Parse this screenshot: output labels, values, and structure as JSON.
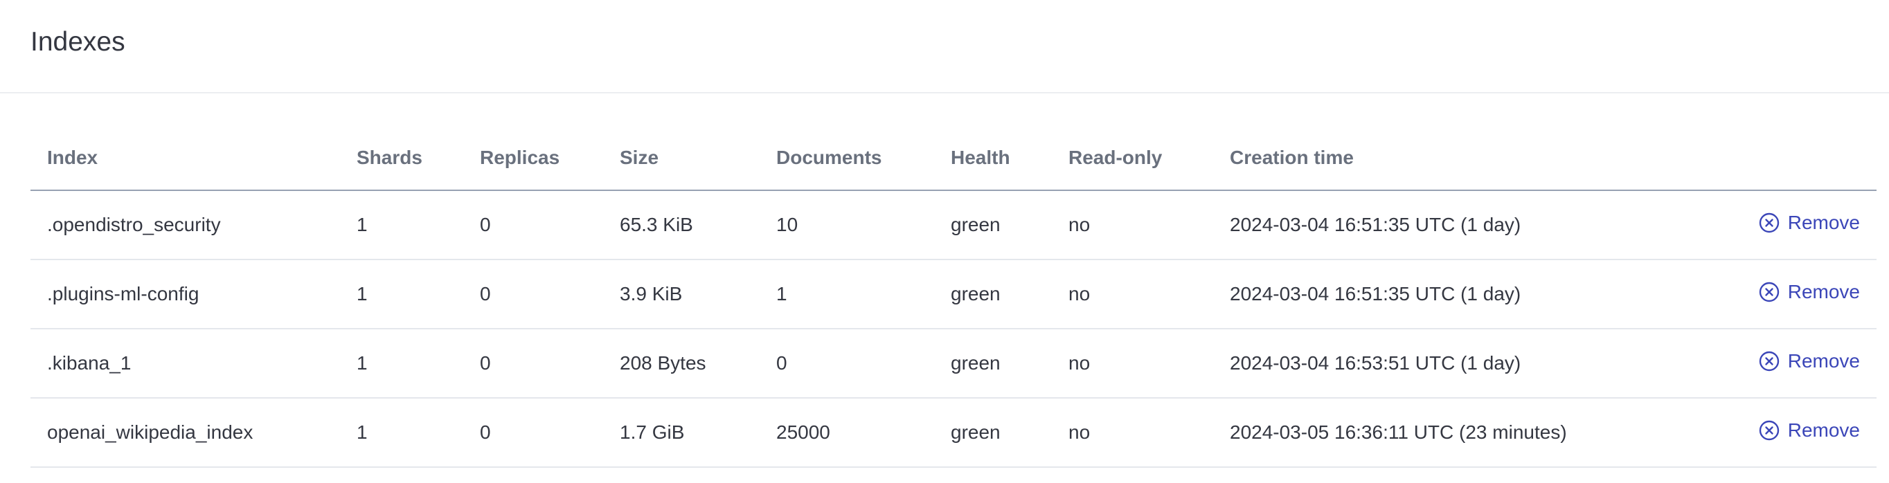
{
  "page": {
    "title": "Indexes"
  },
  "table": {
    "columns": [
      "Index",
      "Shards",
      "Replicas",
      "Size",
      "Documents",
      "Health",
      "Read-only",
      "Creation time"
    ],
    "remove_label": "Remove",
    "rows": [
      {
        "index": ".opendistro_security",
        "shards": "1",
        "replicas": "0",
        "size": "65.3 KiB",
        "documents": "10",
        "health": "green",
        "read_only": "no",
        "creation_time": "2024-03-04 16:51:35 UTC (1 day)"
      },
      {
        "index": ".plugins-ml-config",
        "shards": "1",
        "replicas": "0",
        "size": "3.9 KiB",
        "documents": "1",
        "health": "green",
        "read_only": "no",
        "creation_time": "2024-03-04 16:51:35 UTC (1 day)"
      },
      {
        "index": ".kibana_1",
        "shards": "1",
        "replicas": "0",
        "size": "208 Bytes",
        "documents": "0",
        "health": "green",
        "read_only": "no",
        "creation_time": "2024-03-04 16:53:51 UTC (1 day)"
      },
      {
        "index": "openai_wikipedia_index",
        "shards": "1",
        "replicas": "0",
        "size": "1.7 GiB",
        "documents": "25000",
        "health": "green",
        "read_only": "no",
        "creation_time": "2024-03-05 16:36:11 UTC (23 minutes)"
      }
    ]
  },
  "colors": {
    "link": "#3b46b8",
    "text": "#343741",
    "header_text": "#69707d"
  },
  "icons": {
    "remove": "circle-x-icon"
  }
}
